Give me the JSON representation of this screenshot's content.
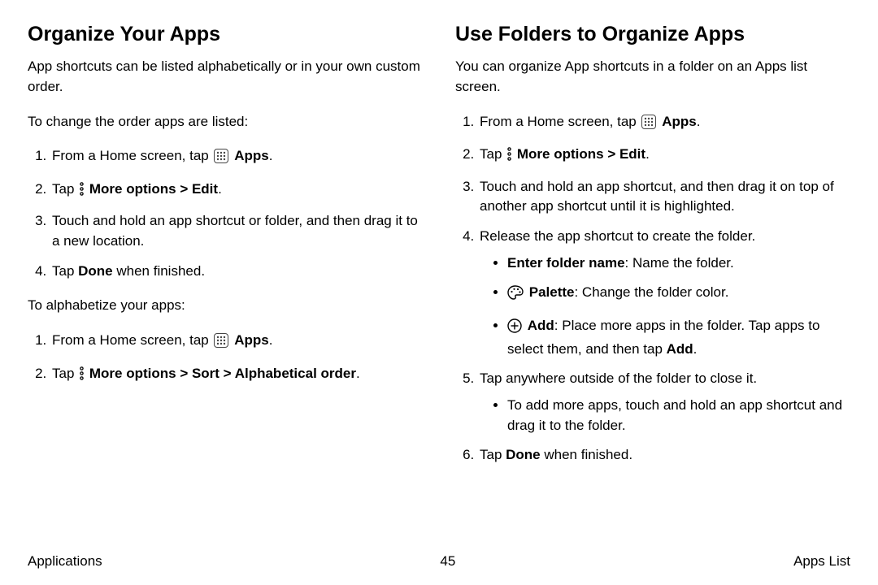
{
  "left": {
    "heading": "Organize Your Apps",
    "intro": "App shortcuts can be listed alphabetically or in your own custom order.",
    "sub1": "To change the order apps are listed:",
    "step1a": "From a Home screen, tap ",
    "step1b_bold": "Apps",
    "step1c": ".",
    "step2a": "Tap ",
    "step2b_bold": "More options > Edit",
    "step2c": ".",
    "step3": "Touch and hold an app shortcut or folder, and then drag it to a new location.",
    "step4a": "Tap ",
    "step4b_bold": "Done",
    "step4c": " when finished.",
    "sub2": "To alphabetize your apps:",
    "alpha1a": "From a Home screen, tap ",
    "alpha1b_bold": "Apps",
    "alpha1c": ".",
    "alpha2a": "Tap ",
    "alpha2b_bold": "More options > Sort > Alphabetical order",
    "alpha2c": "."
  },
  "right": {
    "heading": "Use Folders to Organize Apps",
    "intro": "You can organize App shortcuts in a folder on an Apps list screen.",
    "r1a": "From a Home screen, tap ",
    "r1b_bold": "Apps",
    "r1c": ".",
    "r2a": "Tap ",
    "r2b_bold": "More options > Edit",
    "r2c": ".",
    "r3": "Touch and hold an app shortcut, and then drag it on top of another app shortcut until it is highlighted.",
    "r4": "Release the app shortcut to create the folder.",
    "r4_b1a_bold": "Enter folder name",
    "r4_b1b": ": Name the folder.",
    "r4_b2a_bold": "Palette",
    "r4_b2b": ": Change the folder color.",
    "r4_b3a_bold": "Add",
    "r4_b3b": ": Place more apps in the folder. Tap apps to select them, and then tap ",
    "r4_b3c_bold": "Add",
    "r4_b3d": ".",
    "r5": "Tap anywhere outside of the folder to close it.",
    "r5_b1": "To add more apps, touch and hold an app shortcut and drag it to the folder.",
    "r6a": "Tap ",
    "r6b_bold": "Done",
    "r6c": " when finished."
  },
  "footer": {
    "left": "Applications",
    "center": "45",
    "right": "Apps List"
  }
}
